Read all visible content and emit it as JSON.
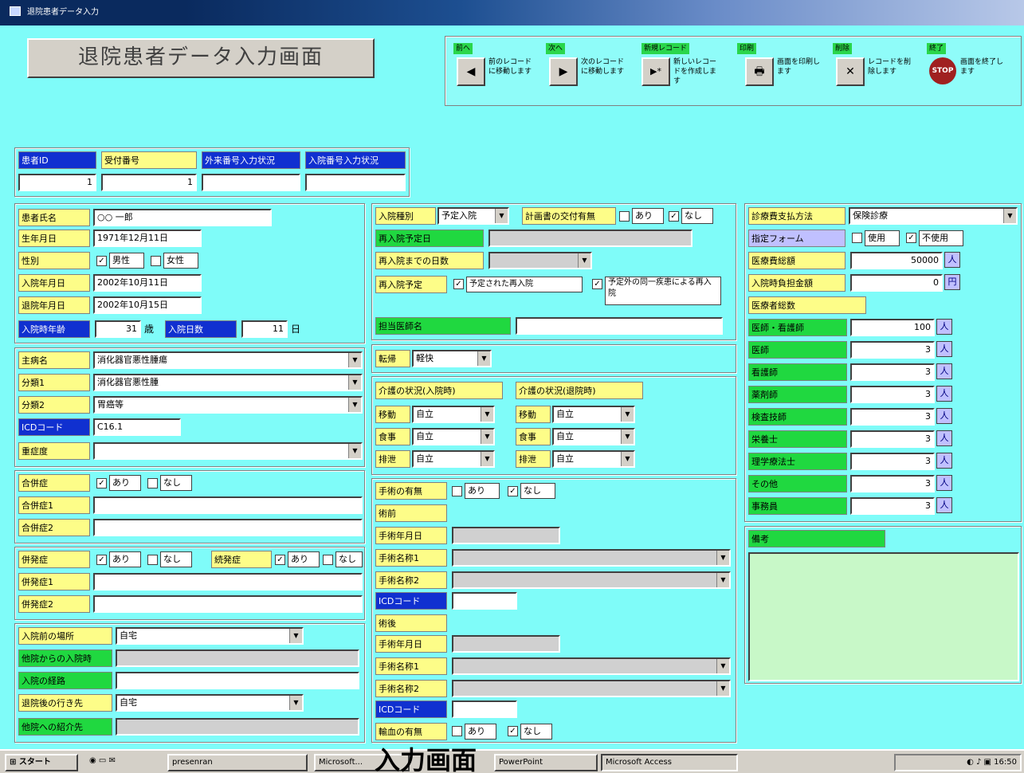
{
  "window": {
    "title": "退院患者データ入力"
  },
  "form_title": "退院患者データ入力画面",
  "nav": [
    {
      "label": "前へ",
      "glyph": "◀",
      "desc": "前のレコードに移動します"
    },
    {
      "label": "次へ",
      "glyph": "▶",
      "desc": "次のレコードに移動します"
    },
    {
      "label": "新規レコード",
      "glyph": "▶*",
      "desc": "新しいレコードを作成します"
    },
    {
      "label": "印刷",
      "glyph": "🖶",
      "desc": "画面を印刷します"
    },
    {
      "label": "削除",
      "glyph": "✕",
      "desc": "レコードを削除します"
    },
    {
      "label": "終了",
      "glyph": "STOP",
      "desc": "画面を終了します"
    }
  ],
  "id_panel": {
    "labels": [
      "患者ID",
      "受付番号",
      "外来番号入力状況",
      "入院番号入力状況"
    ],
    "values": [
      "1",
      "1",
      "",
      ""
    ]
  },
  "patient": {
    "name_label": "患者氏名",
    "name": "○○ 一郎",
    "birth_label": "生年月日",
    "birth": "1971年12月11日",
    "sex_label": "性別",
    "sex_male": "男性",
    "sex_female": "女性",
    "admit_label": "入院年月日",
    "admit": "2002年10月11日",
    "discharge_label": "退院年月日",
    "discharge": "2002年10月15日",
    "age_label": "入院時年齢",
    "age": "31",
    "age_unit": "歳",
    "days_label": "入院日数",
    "days": "11",
    "days_unit": "日"
  },
  "diagnosis": {
    "main_label": "主病名",
    "main": "消化器官悪性腫瘍",
    "sub1_label": "分類1",
    "sub1": "消化器官悪性腫",
    "sub2_label": "分類2",
    "sub2": "胃癌等",
    "icd_label": "ICDコード",
    "icd": "C16.1",
    "severity_label": "重症度",
    "severity": ""
  },
  "comorb": {
    "label": "合併症",
    "yes": "あり",
    "no": "なし",
    "c1_label": "合併症1",
    "c2_label": "合併症2"
  },
  "complication": {
    "label": "併発症",
    "yes": "あり",
    "no": "なし",
    "other_label": "続発症",
    "c1_label": "併発症1",
    "c2_label": "併発症2"
  },
  "route": {
    "pre_label": "入院前の場所",
    "pre": "自宅",
    "transfer_label": "他院からの入院時",
    "path_label": "入院の経路",
    "post_label": "退院後の行き先",
    "post": "自宅",
    "dest_label": "他院への紹介先"
  },
  "admission": {
    "type_label": "入院種別",
    "type": "予定入院",
    "plan_label": "計画書の交付有無",
    "yes": "あり",
    "no": "なし",
    "readmit_date_label": "再入院予定日",
    "readmit_days_label": "再入院までの日数",
    "readmit_plan_label": "再入院予定",
    "readmit_opt1": "予定された再入院",
    "readmit_opt2": "予定外の同一疾患による再入院",
    "doctor_label": "担当医師名"
  },
  "outcome": {
    "label": "転帰",
    "value": "軽快"
  },
  "adl": {
    "adm_title": "介護の状況(入院時)",
    "dis_title": "介護の状況(退院時)",
    "rows": [
      {
        "label": "移動",
        "adm": "自立",
        "dis": "自立"
      },
      {
        "label": "食事",
        "adm": "自立",
        "dis": "自立"
      },
      {
        "label": "排泄",
        "adm": "自立",
        "dis": "自立"
      }
    ]
  },
  "surgery": {
    "has_label": "手術の有無",
    "yes": "あり",
    "no": "なし",
    "s1_title": "術前",
    "date1_label": "手術年月日",
    "proc1a_label": "手術名称1",
    "proc1b_label": "手術名称2",
    "icd1_label": "ICDコード",
    "s2_title": "術後",
    "date2_label": "手術年月日",
    "proc2a_label": "手術名称1",
    "proc2b_label": "手術名称2",
    "icd2_label": "ICDコード",
    "anes_label": "輸血の有無",
    "anes_yes": "あり",
    "anes_no": "なし"
  },
  "billing": {
    "payer_label": "診療費支払方法",
    "payer": "保険診療",
    "form_label": "指定フォーム",
    "form_yes": "使用",
    "form_no": "不使用",
    "total_label": "医療費総額",
    "total": "50000",
    "copay_label": "入院時負担金額",
    "copay": "0",
    "copay_unit": "円",
    "staff_title": "医療者総数",
    "staff_rows": [
      {
        "label": "医師・看護師",
        "value": "100"
      },
      {
        "label": "医師",
        "value": "3"
      },
      {
        "label": "看護師",
        "value": "3"
      },
      {
        "label": "薬剤師",
        "value": "3"
      },
      {
        "label": "検査技師",
        "value": "3"
      },
      {
        "label": "栄養士",
        "value": "3"
      },
      {
        "label": "理学療法士",
        "value": "3"
      },
      {
        "label": "その他",
        "value": "3"
      },
      {
        "label": "事務員",
        "value": "3"
      }
    ],
    "person_unit": "人"
  },
  "notes": {
    "label": "備考",
    "value": ""
  },
  "taskbar": {
    "start": "スタート",
    "items": [
      "presenran",
      "Microsoft...",
      "PowerPoint",
      "Microsoft Access"
    ],
    "clock": "16:50",
    "overlay": "入力画面"
  },
  "colors": {
    "bg": "#7ffcf9",
    "label_yellow": "#fdfd88",
    "label_green": "#20d840",
    "label_blue": "#1030d0"
  }
}
